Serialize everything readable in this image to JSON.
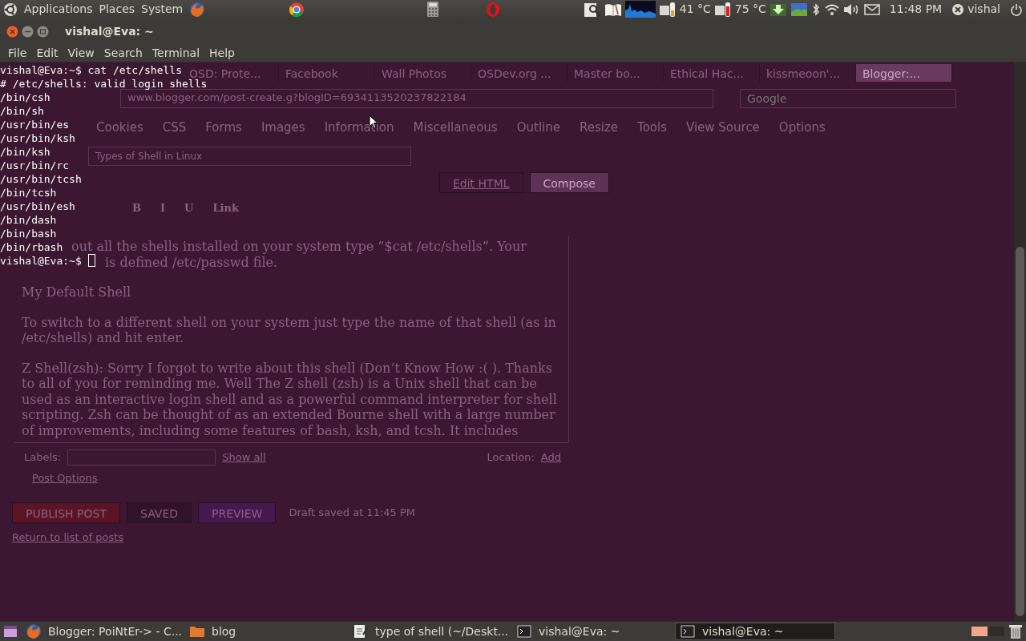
{
  "top_panel": {
    "menus": [
      "Applications",
      "Places",
      "System"
    ],
    "temperatures": [
      "41 °C",
      "75 °C"
    ],
    "clock": "11:48 PM",
    "user": "vishal"
  },
  "terminal": {
    "title": "vishal@Eva: ~",
    "menu": [
      "File",
      "Edit",
      "View",
      "Search",
      "Terminal",
      "Help"
    ],
    "lines": [
      "vishal@Eva:~$ cat /etc/shells",
      "# /etc/shells: valid login shells",
      "/bin/csh",
      "/bin/sh",
      "/usr/bin/es",
      "/usr/bin/ksh",
      "/bin/ksh",
      "/usr/bin/rc",
      "/usr/bin/tcsh",
      "/bin/tcsh",
      "/usr/bin/esh",
      "/bin/dash",
      "/bin/bash",
      "/bin/rbash",
      "vishal@Eva:~$"
    ],
    "cursor": true
  },
  "background_browser": {
    "tabs": [
      {
        "label": "OSD: Prote...",
        "selected": false
      },
      {
        "label": "Facebook",
        "selected": false
      },
      {
        "label": "Wall Photos",
        "selected": false
      },
      {
        "label": "OSDev.org ...",
        "selected": false
      },
      {
        "label": "Master bo...",
        "selected": false
      },
      {
        "label": "Ethical Hac...",
        "selected": false
      },
      {
        "label": "kissmeoon'...",
        "selected": false
      },
      {
        "label": "Blogger:...",
        "selected": true
      }
    ],
    "url": "www.blogger.com/post-create.g?blogID=6934113520237822184",
    "search_placeholder": "Google",
    "toolbar": [
      "Cookies",
      "CSS",
      "Forms",
      "Images",
      "Information",
      "Miscellaneous",
      "Outline",
      "Resize",
      "Tools",
      "View Source",
      "Options"
    ],
    "post_title": "Types of Shell in Linux",
    "mode_tabs": [
      {
        "label": "Edit HTML",
        "selected": false
      },
      {
        "label": "Compose",
        "selected": true
      }
    ],
    "format_buttons": [
      "B",
      "I",
      "U",
      "Link"
    ],
    "paragraphs": [
      [
        "out all the shells installed on your system type “$cat /etc/shells”. Your",
        "is defined /etc/passwd file."
      ],
      [
        "My Default Shell"
      ],
      [
        "To switch to a different shell on your system just type the name of that shell (as in",
        "/etc/shells) and hit enter."
      ],
      [
        "Z Shell(zsh):  Sorry I forgot to write about this shell (Don’t Know How :( ). Thanks",
        "to all of you for reminding me. Well The Z shell (zsh) is a Unix shell that can be",
        "used as an interactive login shell and as a powerful command interpreter for shell",
        "scripting. Zsh can be thought of as an extended Bourne shell with a large number",
        "of improvements, including some features of bash, ksh, and tcsh. It includes"
      ]
    ],
    "labels_label": "Labels:",
    "show_all": "Show all",
    "location_label": "Location:",
    "add_link": "Add",
    "post_options": "Post Options",
    "buttons": [
      {
        "label": "PUBLISH POST",
        "kind": "publish"
      },
      {
        "label": "SAVED",
        "kind": "saved"
      },
      {
        "label": "PREVIEW",
        "kind": "preview"
      }
    ],
    "draft_status": "Draft saved at 11:45 PM",
    "return_link": "Return to list of posts"
  },
  "taskbar": {
    "tasks": [
      {
        "label": "Blogger: PoiNtEr-> - C...",
        "kind": "browser",
        "selected": false
      },
      {
        "label": "blog",
        "kind": "folder",
        "selected": false
      },
      {
        "label": "type of shell (~/Deskt...",
        "kind": "editor",
        "selected": false
      },
      {
        "label": "vishal@Eva: ~",
        "kind": "terminal",
        "selected": false
      },
      {
        "label": "vishal@Eva: ~",
        "kind": "terminal",
        "selected": true
      }
    ]
  }
}
